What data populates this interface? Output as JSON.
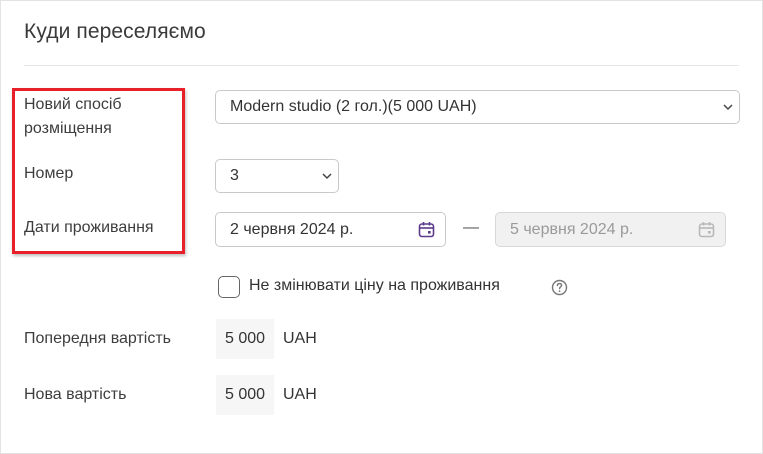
{
  "title": "Куди переселяємо",
  "fields": {
    "accommodation_label": "Новий спосіб\nрозміщення",
    "accommodation_value": "Modern studio (2 гол.)(5 000 UAH)",
    "room_label": "Номер",
    "room_value": "3",
    "dates_label": "Дати проживання",
    "date_from": "2 червня 2024 р.",
    "date_separator": "—",
    "date_to": "5 червня 2024 р."
  },
  "keep_price": {
    "label": "Не змінювати ціну на проживання",
    "checked": false
  },
  "costs": {
    "previous_label": "Попередня вартість",
    "previous_value": "5 000",
    "previous_currency": "UAH",
    "new_label": "Нова вартість",
    "new_value": "5 000",
    "new_currency": "UAH"
  },
  "colors": {
    "highlight": "#e8202a",
    "calendar_icon_active": "#5b3a8c",
    "calendar_icon_disabled": "#b8b8b8"
  }
}
